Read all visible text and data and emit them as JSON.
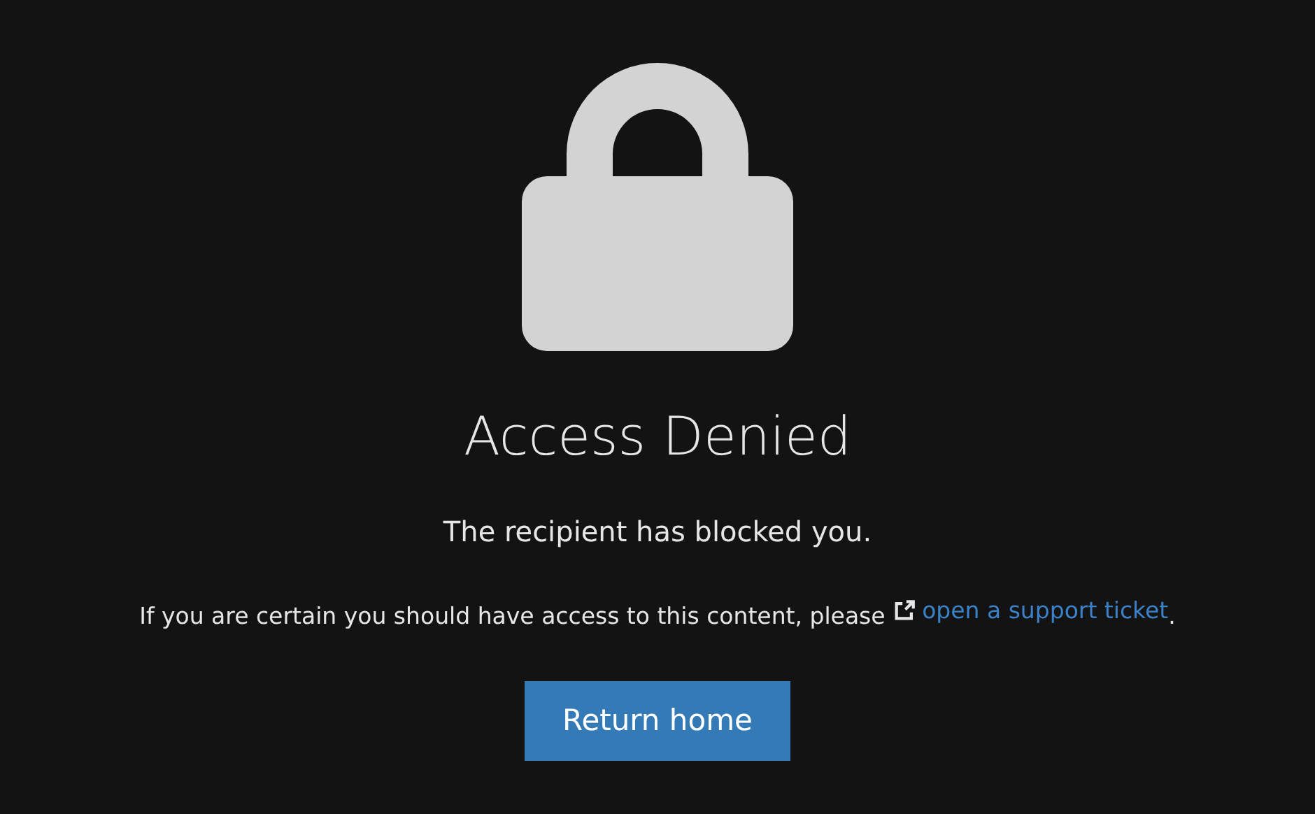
{
  "title": "Access Denied",
  "message": "The recipient has blocked you.",
  "help": {
    "text_before": "If you are certain you should have access to this content, please",
    "link": "open a support ticket",
    "text_after": "."
  },
  "button": {
    "label": "Return home"
  }
}
